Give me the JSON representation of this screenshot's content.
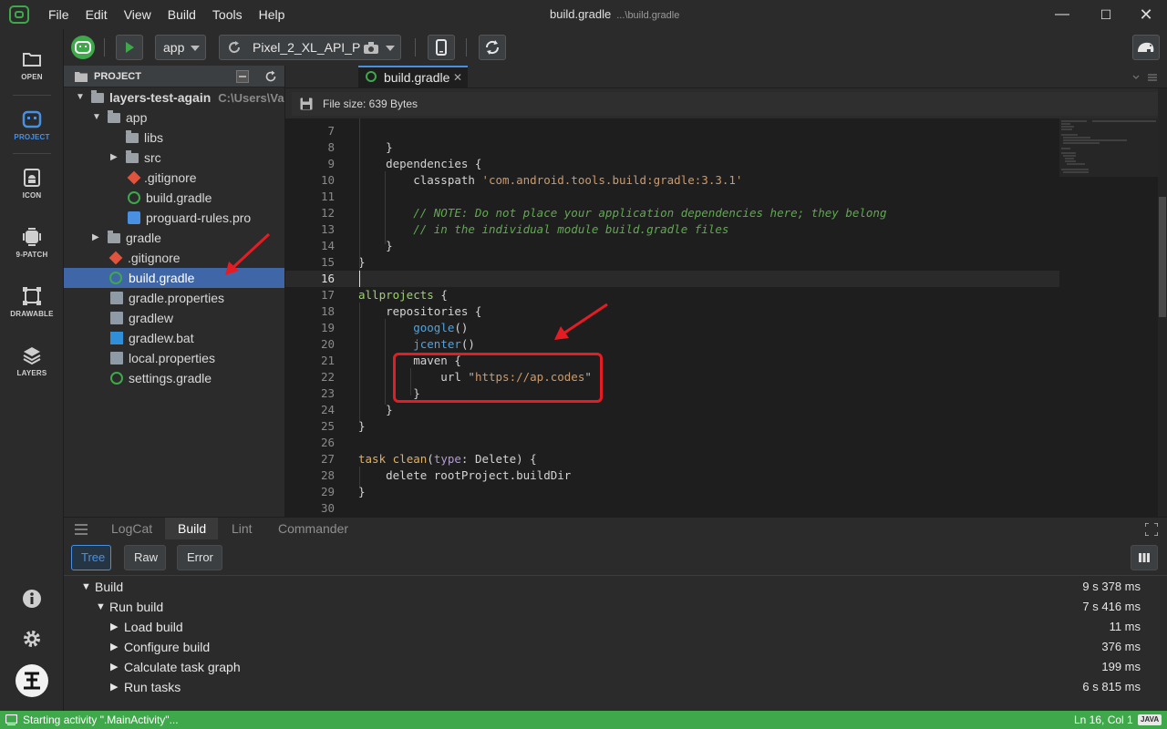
{
  "menu": [
    "File",
    "Edit",
    "View",
    "Build",
    "Tools",
    "Help"
  ],
  "window": {
    "title": "build.gradle",
    "path": "...\\build.gradle"
  },
  "activity_bar": [
    {
      "label": "OPEN",
      "icon": "folder-icon"
    },
    {
      "label": "PROJECT",
      "icon": "project-icon"
    },
    {
      "label": "ICON",
      "icon": "android-icon"
    },
    {
      "label": "9-PATCH",
      "icon": "ninepatch-icon"
    },
    {
      "label": "DRAWABLE",
      "icon": "drawable-icon"
    },
    {
      "label": "LAYERS",
      "icon": "layers-icon"
    }
  ],
  "toolbar": {
    "module": "app",
    "device": "Pixel_2_XL_API_P"
  },
  "project": {
    "header": "PROJECT",
    "root": {
      "name": "layers-test-again",
      "path": "C:\\Users\\Vasil"
    },
    "items": [
      {
        "name": "app"
      },
      {
        "name": "libs"
      },
      {
        "name": "src"
      },
      {
        "name": ".gitignore"
      },
      {
        "name": "build.gradle"
      },
      {
        "name": "proguard-rules.pro"
      },
      {
        "name": "gradle"
      },
      {
        "name": ".gitignore"
      },
      {
        "name": "build.gradle"
      },
      {
        "name": "gradle.properties"
      },
      {
        "name": "gradlew"
      },
      {
        "name": "gradlew.bat"
      },
      {
        "name": "local.properties"
      },
      {
        "name": "settings.gradle"
      }
    ]
  },
  "editor": {
    "tab": "build.gradle",
    "file_info": "File size: 639 Bytes",
    "current_line": 16,
    "lines": [
      {
        "n": "7",
        "parts": []
      },
      {
        "n": "8",
        "parts": [
          {
            "t": "    }",
            "c": ""
          }
        ]
      },
      {
        "n": "9",
        "parts": [
          {
            "t": "    dependencies {",
            "c": ""
          }
        ]
      },
      {
        "n": "10",
        "parts": [
          {
            "t": "        classpath ",
            "c": ""
          },
          {
            "t": "'com.android.tools.build:gradle:3.3.1'",
            "c": "str"
          }
        ]
      },
      {
        "n": "11",
        "parts": []
      },
      {
        "n": "12",
        "parts": [
          {
            "t": "        // NOTE: Do not place your application dependencies here; they belong",
            "c": "cm"
          }
        ]
      },
      {
        "n": "13",
        "parts": [
          {
            "t": "        // in the individual module build.gradle files",
            "c": "cm"
          }
        ]
      },
      {
        "n": "14",
        "parts": [
          {
            "t": "    }",
            "c": ""
          }
        ]
      },
      {
        "n": "15",
        "parts": [
          {
            "t": "}",
            "c": ""
          }
        ]
      },
      {
        "n": "16",
        "parts": []
      },
      {
        "n": "17",
        "parts": [
          {
            "t": "allprojects",
            "c": "grn"
          },
          {
            "t": " {",
            "c": ""
          }
        ]
      },
      {
        "n": "18",
        "parts": [
          {
            "t": "    repositories {",
            "c": ""
          }
        ]
      },
      {
        "n": "19",
        "parts": [
          {
            "t": "        ",
            "c": ""
          },
          {
            "t": "google",
            "c": "fn"
          },
          {
            "t": "()",
            "c": ""
          }
        ]
      },
      {
        "n": "20",
        "parts": [
          {
            "t": "        ",
            "c": ""
          },
          {
            "t": "jcenter",
            "c": "fn"
          },
          {
            "t": "()",
            "c": ""
          }
        ]
      },
      {
        "n": "21",
        "parts": [
          {
            "t": "        maven {",
            "c": ""
          }
        ]
      },
      {
        "n": "22",
        "parts": [
          {
            "t": "            url ",
            "c": ""
          },
          {
            "t": "\"",
            "c": "str-g"
          },
          {
            "t": "https://ap.codes",
            "c": "str"
          },
          {
            "t": "\"",
            "c": "str-g"
          }
        ]
      },
      {
        "n": "23",
        "parts": [
          {
            "t": "        }",
            "c": ""
          }
        ]
      },
      {
        "n": "24",
        "parts": [
          {
            "t": "    }",
            "c": ""
          }
        ]
      },
      {
        "n": "25",
        "parts": [
          {
            "t": "}",
            "c": ""
          }
        ]
      },
      {
        "n": "26",
        "parts": []
      },
      {
        "n": "27",
        "parts": [
          {
            "t": "task ",
            "c": "kw"
          },
          {
            "t": "clean",
            "c": "kw"
          },
          {
            "t": "(",
            "c": ""
          },
          {
            "t": "type",
            "c": "purp"
          },
          {
            "t": ": Delete) {",
            "c": ""
          }
        ]
      },
      {
        "n": "28",
        "parts": [
          {
            "t": "    delete rootProject.buildDir",
            "c": ""
          }
        ]
      },
      {
        "n": "29",
        "parts": [
          {
            "t": "}",
            "c": ""
          }
        ]
      },
      {
        "n": "30",
        "parts": []
      }
    ]
  },
  "bottom_panel": {
    "tabs": [
      "LogCat",
      "Build",
      "Lint",
      "Commander"
    ],
    "active_tab": "Build",
    "view_modes": [
      "Tree",
      "Raw",
      "Error"
    ],
    "active_mode": "Tree",
    "build_tree": [
      {
        "label": "Build",
        "duration": "9 s 378 ms",
        "level": 0,
        "expanded": true
      },
      {
        "label": "Run build",
        "duration": "7 s 416 ms",
        "level": 1,
        "expanded": true
      },
      {
        "label": "Load build",
        "duration": "11 ms",
        "level": 2,
        "expanded": false
      },
      {
        "label": "Configure build",
        "duration": "376 ms",
        "level": 2,
        "expanded": false
      },
      {
        "label": "Calculate task graph",
        "duration": "199 ms",
        "level": 2,
        "expanded": false
      },
      {
        "label": "Run tasks",
        "duration": "6 s 815 ms",
        "level": 2,
        "expanded": false
      }
    ]
  },
  "status": {
    "message": "Starting activity \".MainActivity\"...",
    "position": "Ln 16, Col 1",
    "language": "JAVA"
  },
  "colors": {
    "accent": "#4a90e2",
    "status_bar": "#3ea84a",
    "annotation": "#e51c23"
  }
}
